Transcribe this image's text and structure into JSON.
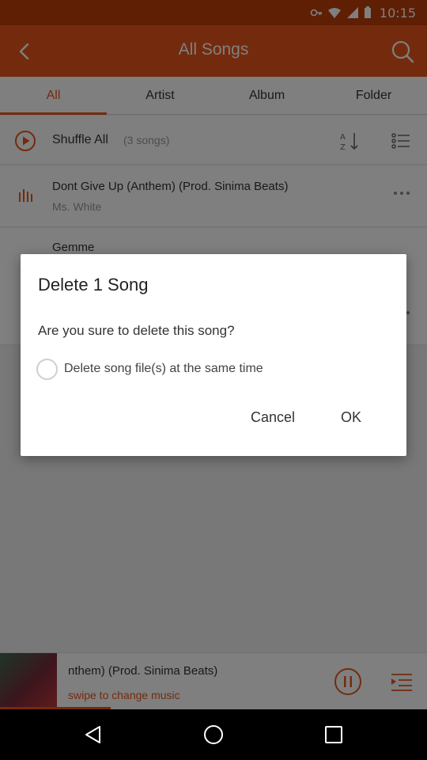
{
  "status_bar": {
    "time": "10:15"
  },
  "app_bar": {
    "title": "All Songs"
  },
  "tabs": [
    {
      "label": "All",
      "active": true
    },
    {
      "label": "Artist",
      "active": false
    },
    {
      "label": "Album",
      "active": false
    },
    {
      "label": "Folder",
      "active": false
    }
  ],
  "shuffle": {
    "label": "Shuffle All",
    "count": "(3 songs)"
  },
  "songs": [
    {
      "title": "Dont Give Up (Anthem) (Prod. Sinima Beats)",
      "artist": "Ms. White"
    },
    {
      "title": "Gemme",
      "artist": ""
    }
  ],
  "player": {
    "title": "nthem) (Prod. Sinima Beats)",
    "subtitle": "swipe to change music",
    "progress": 0.26
  },
  "dialog": {
    "title": "Delete 1 Song",
    "message": "Are you sure to delete this song?",
    "checkbox_label": "Delete song file(s) at the same time",
    "checkbox_checked": false,
    "cancel_label": "Cancel",
    "ok_label": "OK"
  },
  "colors": {
    "accent": "#e8561a",
    "status_bar": "#bf3e0b"
  }
}
